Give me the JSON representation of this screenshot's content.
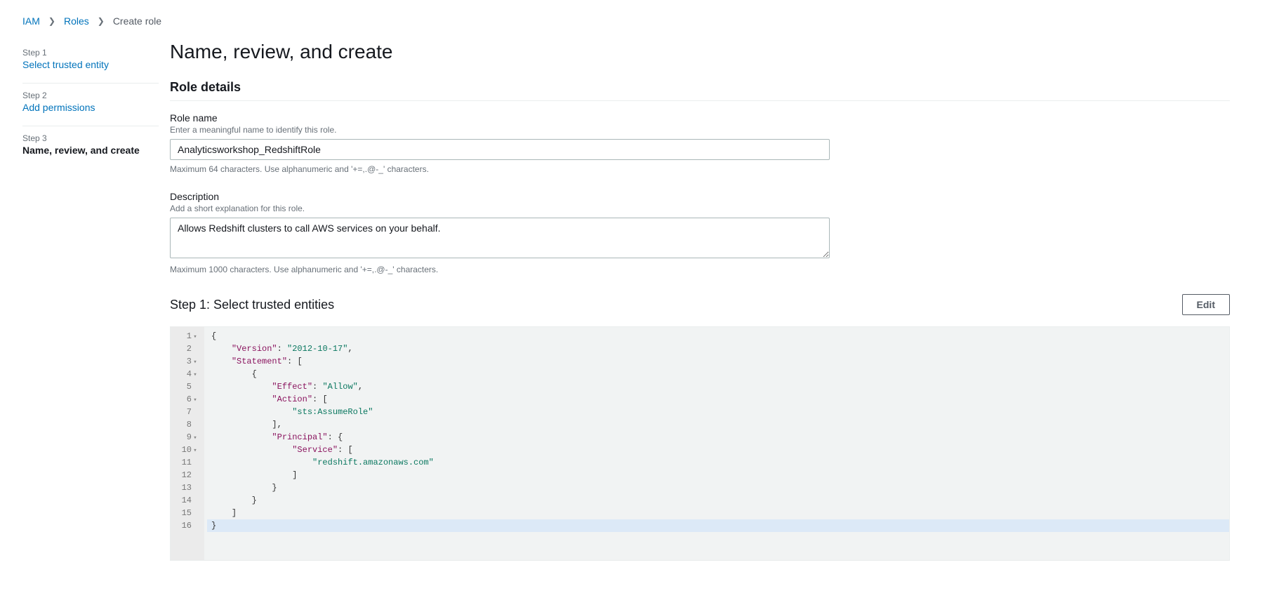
{
  "breadcrumb": {
    "root": "IAM",
    "mid": "Roles",
    "current": "Create role"
  },
  "sidebar": {
    "steps": [
      {
        "label": "Step 1",
        "title": "Select trusted entity",
        "active": false
      },
      {
        "label": "Step 2",
        "title": "Add permissions",
        "active": false
      },
      {
        "label": "Step 3",
        "title": "Name, review, and create",
        "active": true
      }
    ]
  },
  "main": {
    "title": "Name, review, and create",
    "section_role_details": "Role details",
    "role_name": {
      "label": "Role name",
      "hint": "Enter a meaningful name to identify this role.",
      "value": "Analyticsworkshop_RedshiftRole",
      "help": "Maximum 64 characters. Use alphanumeric and '+=,.@-_' characters."
    },
    "description": {
      "label": "Description",
      "hint": "Add a short explanation for this role.",
      "value": "Allows Redshift clusters to call AWS services on your behalf.",
      "help": "Maximum 1000 characters. Use alphanumeric and '+=,.@-_' characters."
    },
    "trusted_entities": {
      "title": "Step 1: Select trusted entities",
      "edit_label": "Edit",
      "policy": {
        "Version": "2012-10-17",
        "Statement": [
          {
            "Effect": "Allow",
            "Action": [
              "sts:AssumeRole"
            ],
            "Principal": {
              "Service": [
                "redshift.amazonaws.com"
              ]
            }
          }
        ]
      },
      "code_lines": [
        {
          "n": 1,
          "fold": true,
          "html": "<span class='tok-brace'>{</span>"
        },
        {
          "n": 2,
          "fold": false,
          "html": "    <span class='tok-key'>\"Version\"</span><span class='tok-punc'>:</span> <span class='tok-str'>\"2012-10-17\"</span><span class='tok-punc'>,</span>"
        },
        {
          "n": 3,
          "fold": true,
          "html": "    <span class='tok-key'>\"Statement\"</span><span class='tok-punc'>:</span> <span class='tok-brace'>[</span>"
        },
        {
          "n": 4,
          "fold": true,
          "html": "        <span class='tok-brace'>{</span>"
        },
        {
          "n": 5,
          "fold": false,
          "html": "            <span class='tok-key'>\"Effect\"</span><span class='tok-punc'>:</span> <span class='tok-str'>\"Allow\"</span><span class='tok-punc'>,</span>"
        },
        {
          "n": 6,
          "fold": true,
          "html": "            <span class='tok-key'>\"Action\"</span><span class='tok-punc'>:</span> <span class='tok-brace'>[</span>"
        },
        {
          "n": 7,
          "fold": false,
          "html": "                <span class='tok-str'>\"sts:AssumeRole\"</span>"
        },
        {
          "n": 8,
          "fold": false,
          "html": "            <span class='tok-brace'>]</span><span class='tok-punc'>,</span>"
        },
        {
          "n": 9,
          "fold": true,
          "html": "            <span class='tok-key'>\"Principal\"</span><span class='tok-punc'>:</span> <span class='tok-brace'>{</span>"
        },
        {
          "n": 10,
          "fold": true,
          "html": "                <span class='tok-key'>\"Service\"</span><span class='tok-punc'>:</span> <span class='tok-brace'>[</span>"
        },
        {
          "n": 11,
          "fold": false,
          "html": "                    <span class='tok-str'>\"redshift.amazonaws.com\"</span>"
        },
        {
          "n": 12,
          "fold": false,
          "html": "                <span class='tok-brace'>]</span>"
        },
        {
          "n": 13,
          "fold": false,
          "html": "            <span class='tok-brace'>}</span>"
        },
        {
          "n": 14,
          "fold": false,
          "html": "        <span class='tok-brace'>}</span>"
        },
        {
          "n": 15,
          "fold": false,
          "html": "    <span class='tok-brace'>]</span>"
        },
        {
          "n": 16,
          "fold": false,
          "hl": true,
          "html": "<span class='tok-brace'>}</span>"
        }
      ]
    }
  }
}
